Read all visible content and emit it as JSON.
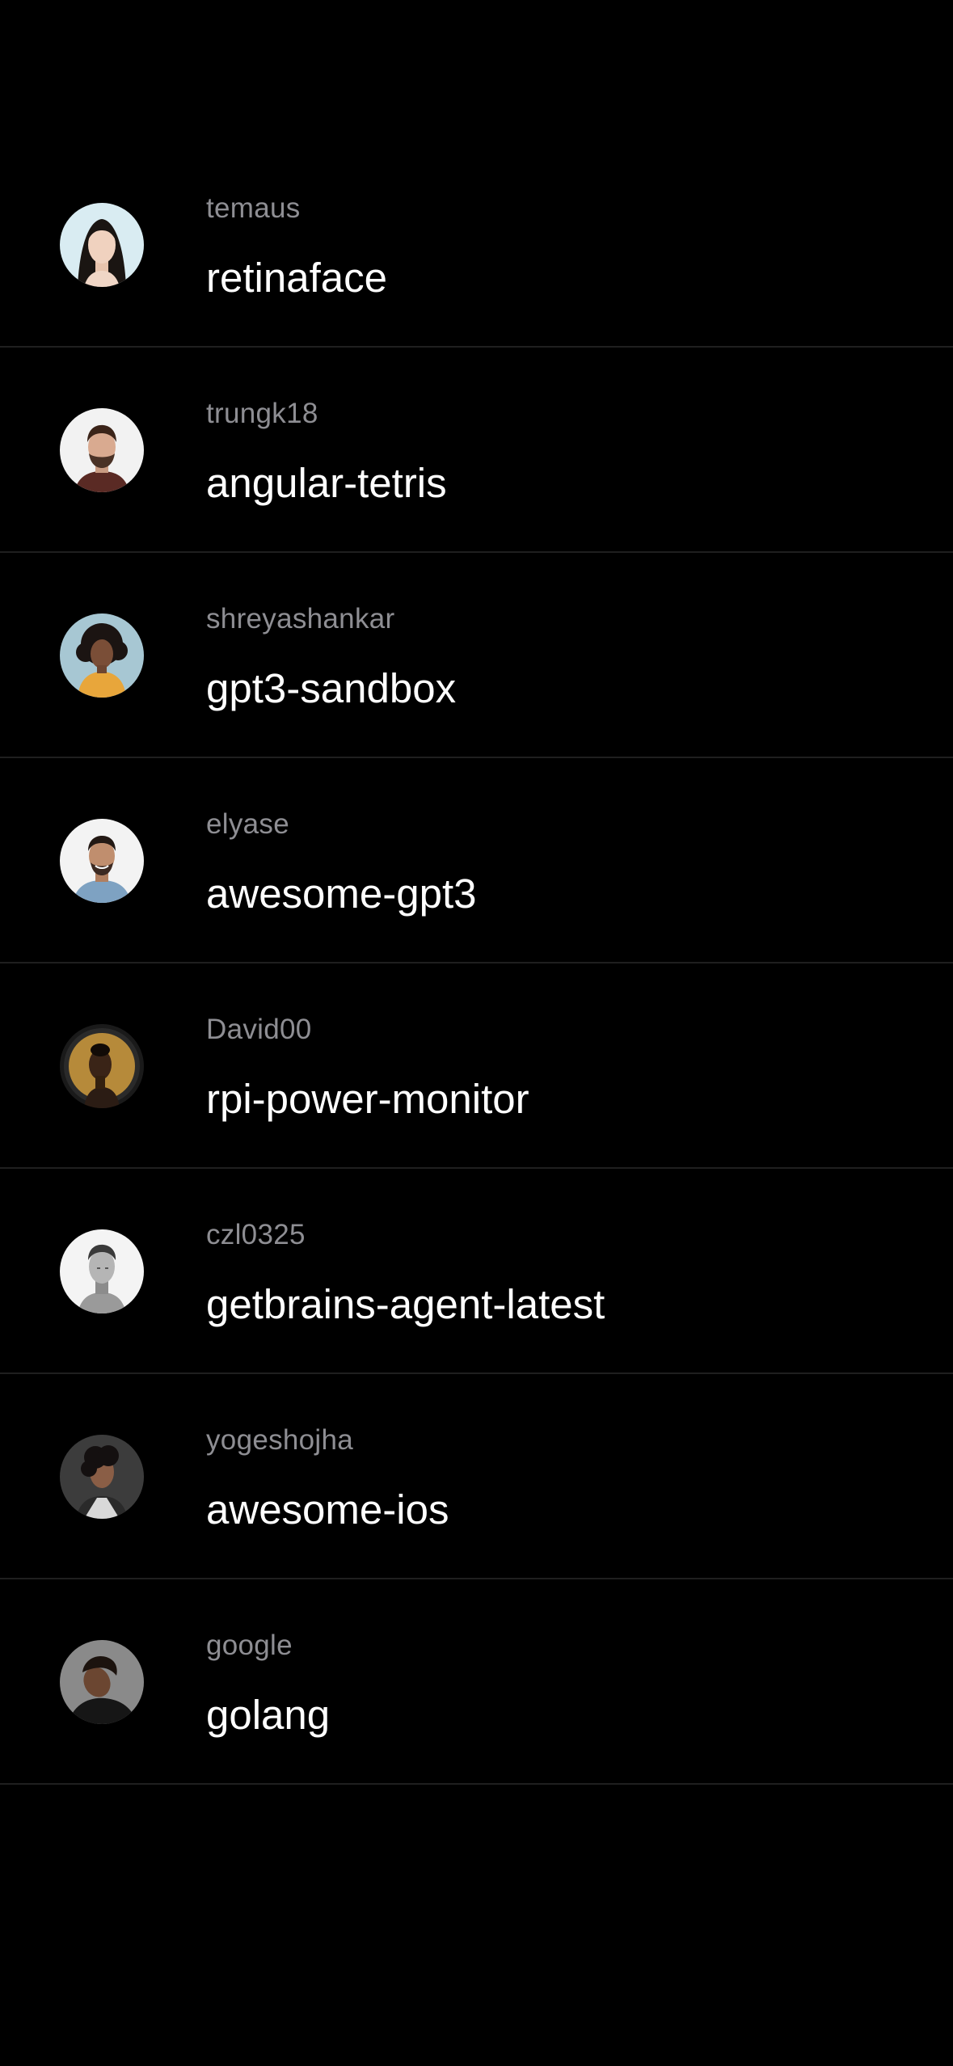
{
  "repos": [
    {
      "owner": "temaus",
      "name": "retinaface"
    },
    {
      "owner": "trungk18",
      "name": "angular-tetris"
    },
    {
      "owner": "shreyashankar",
      "name": "gpt3-sandbox"
    },
    {
      "owner": "elyase",
      "name": "awesome-gpt3"
    },
    {
      "owner": "David00",
      "name": "rpi-power-monitor"
    },
    {
      "owner": "czl0325",
      "name": "getbrains-agent-latest"
    },
    {
      "owner": "yogeshojha",
      "name": "awesome-ios"
    },
    {
      "owner": "google",
      "name": "golang"
    }
  ]
}
